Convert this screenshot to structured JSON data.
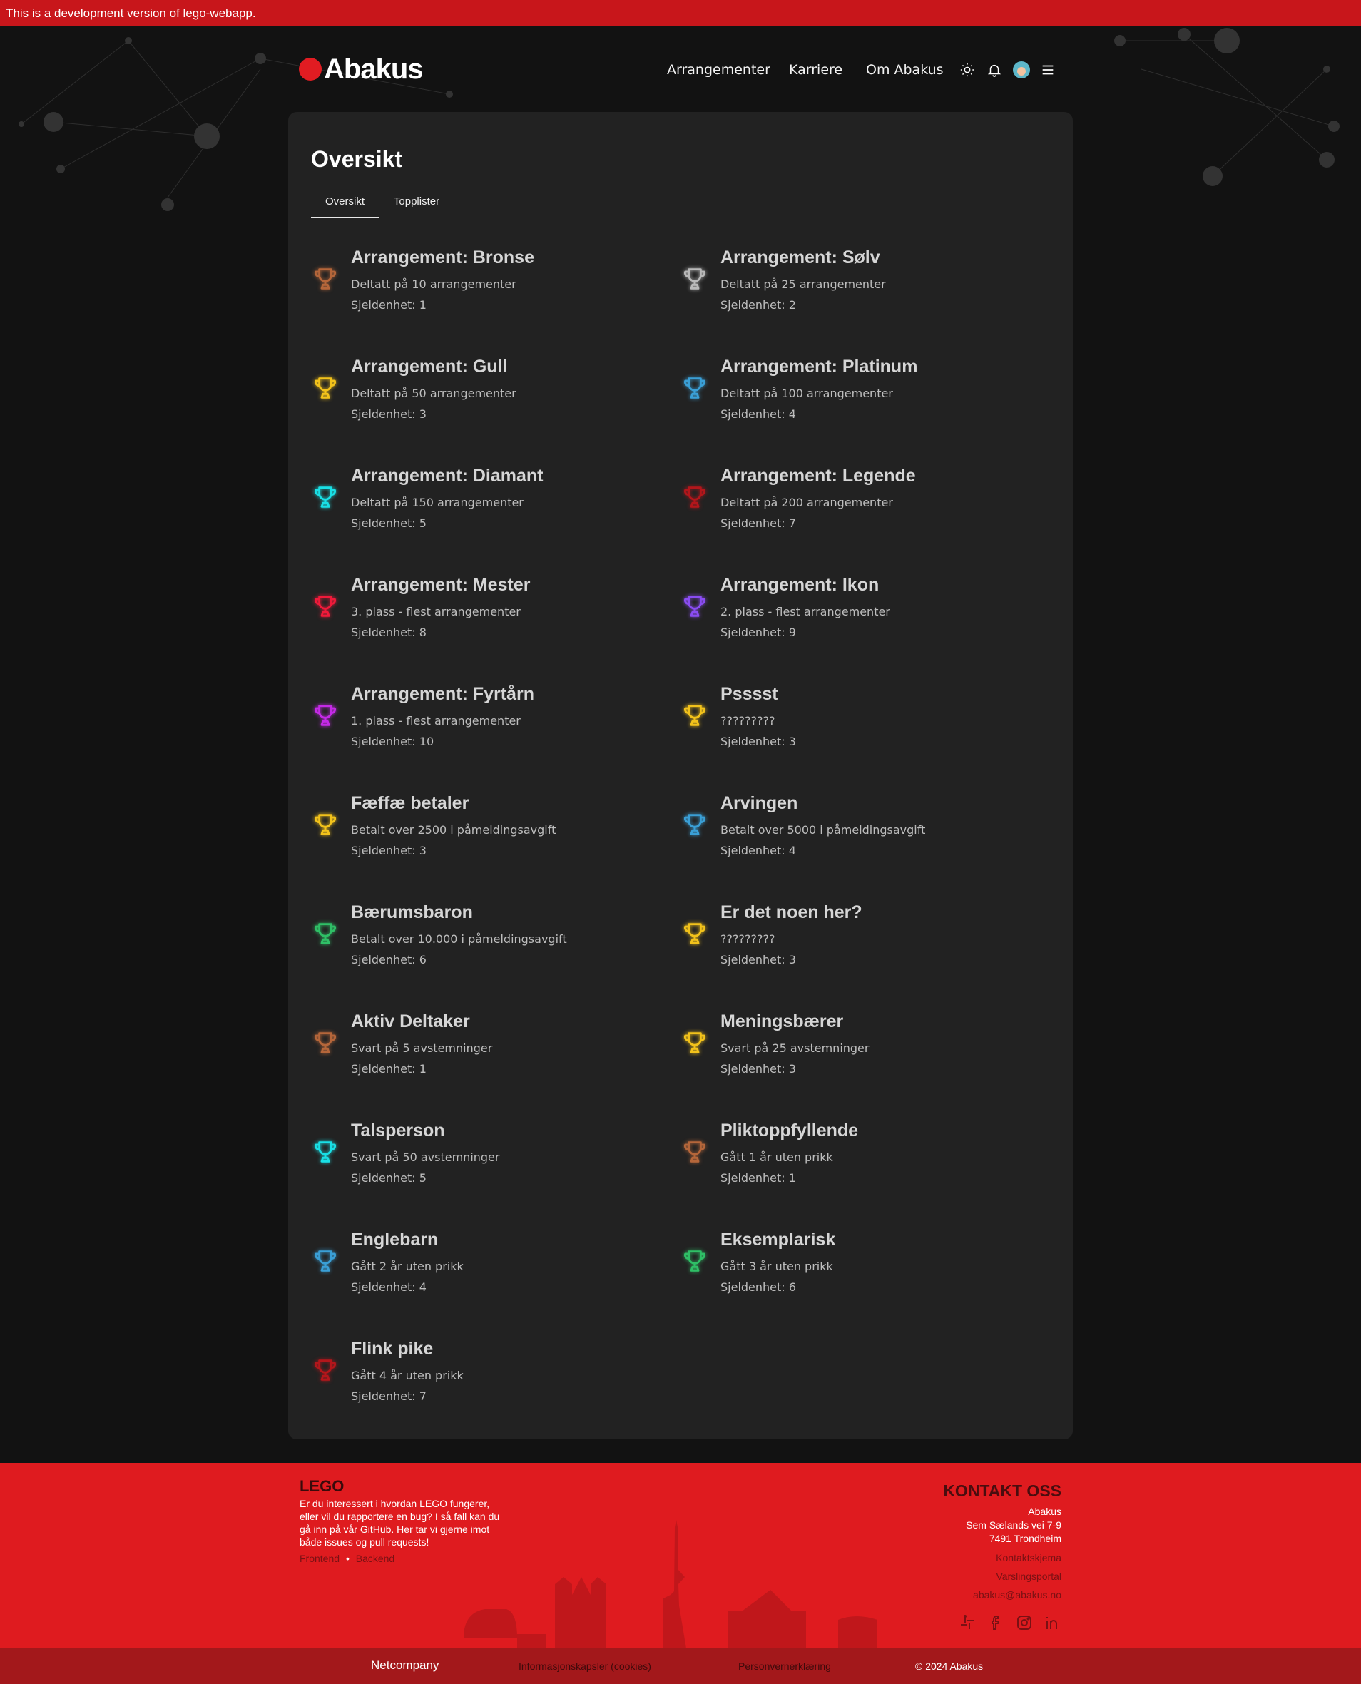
{
  "dev_banner": "This is a development version of lego-webapp.",
  "header": {
    "logo_text": "Abakus",
    "nav": [
      "Arrangementer",
      "Karriere",
      "Om Abakus"
    ],
    "icons": [
      "sun-icon",
      "bell-icon",
      "avatar",
      "menu-icon"
    ]
  },
  "page": {
    "title": "Oversikt",
    "tabs": [
      "Oversikt",
      "Topplister"
    ],
    "active_tab": "Oversikt"
  },
  "achievements": [
    {
      "title": "Arrangement: Bronse",
      "desc": "Deltatt på 10 arrangementer",
      "rarity": "Sjeldenhet: 1",
      "color": "#b5663a"
    },
    {
      "title": "Arrangement: Sølv",
      "desc": "Deltatt på 25 arrangementer",
      "rarity": "Sjeldenhet: 2",
      "color": "#b9b9b9"
    },
    {
      "title": "Arrangement: Gull",
      "desc": "Deltatt på 50 arrangementer",
      "rarity": "Sjeldenhet: 3",
      "color": "#f2c21b"
    },
    {
      "title": "Arrangement: Platinum",
      "desc": "Deltatt på 100 arrangementer",
      "rarity": "Sjeldenhet: 4",
      "color": "#3a9fd6"
    },
    {
      "title": "Arrangement: Diamant",
      "desc": "Deltatt på 150 arrangementer",
      "rarity": "Sjeldenhet: 5",
      "color": "#19e0e6"
    },
    {
      "title": "Arrangement: Legende",
      "desc": "Deltatt på 200 arrangementer",
      "rarity": "Sjeldenhet: 7",
      "color": "#b3161b"
    },
    {
      "title": "Arrangement: Mester",
      "desc": "3. plass - flest arrangementer",
      "rarity": "Sjeldenhet: 8",
      "color": "#f01a3a"
    },
    {
      "title": "Arrangement: Ikon",
      "desc": "2. plass - flest arrangementer",
      "rarity": "Sjeldenhet: 9",
      "color": "#8a4cf2"
    },
    {
      "title": "Arrangement: Fyrtårn",
      "desc": "1. plass - flest arrangementer",
      "rarity": "Sjeldenhet: 10",
      "color": "#c42ae6"
    },
    {
      "title": "Psssst",
      "desc": "?????????",
      "rarity": "Sjeldenhet: 3",
      "color": "#f2c21b"
    },
    {
      "title": "Fæffæ betaler",
      "desc": "Betalt over 2500 i påmeldingsavgift",
      "rarity": "Sjeldenhet: 3",
      "color": "#f2c21b"
    },
    {
      "title": "Arvingen",
      "desc": "Betalt over 5000 i påmeldingsavgift",
      "rarity": "Sjeldenhet: 4",
      "color": "#3a9fd6"
    },
    {
      "title": "Bærumsbaron",
      "desc": "Betalt over 10.000 i påmeldingsavgift",
      "rarity": "Sjeldenhet: 6",
      "color": "#2fbf66"
    },
    {
      "title": "Er det noen her?",
      "desc": "?????????",
      "rarity": "Sjeldenhet: 3",
      "color": "#f2c21b"
    },
    {
      "title": "Aktiv Deltaker",
      "desc": "Svart på 5 avstemninger",
      "rarity": "Sjeldenhet: 1",
      "color": "#b5663a"
    },
    {
      "title": "Meningsbærer",
      "desc": "Svart på 25 avstemninger",
      "rarity": "Sjeldenhet: 3",
      "color": "#f2c21b"
    },
    {
      "title": "Talsperson",
      "desc": "Svart på 50 avstemninger",
      "rarity": "Sjeldenhet: 5",
      "color": "#19e0e6"
    },
    {
      "title": "Pliktoppfyllende",
      "desc": "Gått 1 år uten prikk",
      "rarity": "Sjeldenhet: 1",
      "color": "#b5663a"
    },
    {
      "title": "Englebarn",
      "desc": "Gått 2 år uten prikk",
      "rarity": "Sjeldenhet: 4",
      "color": "#3a9fd6"
    },
    {
      "title": "Eksemplarisk",
      "desc": "Gått 3 år uten prikk",
      "rarity": "Sjeldenhet: 6",
      "color": "#2fbf66"
    },
    {
      "title": "Flink pike",
      "desc": "Gått 4 år uten prikk",
      "rarity": "Sjeldenhet: 7",
      "color": "#b3161b"
    }
  ],
  "footer": {
    "lego_title": "LEGO",
    "lego_desc": "Er du interessert i hvordan LEGO fungerer, eller vil du rapportere en bug? I så fall kan du gå inn på vår GitHub. Her tar vi gjerne imot både issues og pull requests!",
    "link_frontend": "Frontend",
    "link_separator": "•",
    "link_backend": "Backend",
    "contact_title": "KONTAKT OSS",
    "address": [
      "Abakus",
      "Sem Sælands vei 7-9",
      "7491 Trondheim"
    ],
    "contact_links": [
      "Kontaktskjema",
      "Varslingsportal",
      "abakus@abakus.no"
    ],
    "socials": [
      "slack-icon",
      "facebook-icon",
      "instagram-icon",
      "linkedin-icon"
    ]
  },
  "bottom_bar": {
    "sponsor": "Netcompany",
    "cookies": "Informasjonskapsler (cookies)",
    "privacy": "Personvernerklæring",
    "copyright": "© 2024 Abakus"
  }
}
